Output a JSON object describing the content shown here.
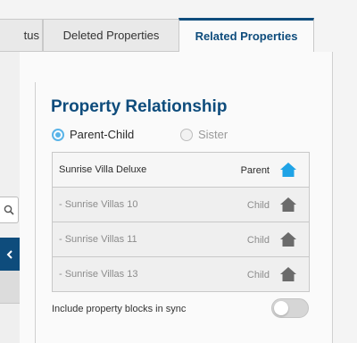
{
  "tabs": [
    {
      "label": "tus"
    },
    {
      "label": "Deleted Properties"
    },
    {
      "label": "Related Properties"
    }
  ],
  "panel": {
    "title": "Property Relationship",
    "relationship_options": [
      {
        "label": "Parent-Child",
        "selected": true
      },
      {
        "label": "Sister",
        "selected": false
      }
    ]
  },
  "properties": [
    {
      "name": "Sunrise Villa Deluxe",
      "role": "Parent"
    },
    {
      "name": "-   Sunrise Villas 10",
      "role": "Child"
    },
    {
      "name": "-   Sunrise Villas 11",
      "role": "Child"
    },
    {
      "name": "-   Sunrise Villas 13",
      "role": "Child"
    }
  ],
  "sync": {
    "label": "Include property blocks in sync",
    "enabled": false
  },
  "colors": {
    "accent": "#0e4c7c",
    "parent_icon": "#1fa3e6",
    "child_icon": "#6b6b6b"
  },
  "icons": {
    "parent": "house-icon",
    "child": "house-icon",
    "search": "search-icon",
    "nav": "chevron-left-icon"
  }
}
